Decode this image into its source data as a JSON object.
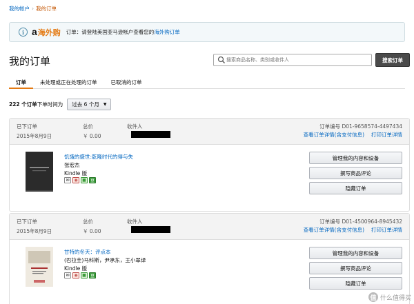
{
  "breadcrumb": {
    "account": "我的帐户",
    "separator": "›",
    "current": "我的订单"
  },
  "notice": {
    "icon": "info-icon",
    "logo_a": "a",
    "logo_cn": "海外购",
    "text_prefix": "订单：请登陆美国亚马逊帐户查看您的",
    "text_link": "海外购订单"
  },
  "page_title": "我的订单",
  "search": {
    "placeholder": "搜索商品名称、类别或收件人",
    "button_label": "搜索订单"
  },
  "tabs": [
    {
      "label": "订单",
      "active": true
    },
    {
      "label": "未处理或正在处理的订单",
      "active": false
    },
    {
      "label": "已取消的订单",
      "active": false
    }
  ],
  "filter": {
    "count": "222 个订单",
    "mid_text": "下单时间为",
    "selected": "过去 6 个月"
  },
  "orders": [
    {
      "placed_label": "已下订单",
      "placed_date": "2015年8月9日",
      "total_label": "总价",
      "total_value": "￥ 0.00",
      "recipient_label": "收件人",
      "order_number": "订单编号 D01-9658574-4497434",
      "details_link": "查看订单详情(含支付信息)",
      "print_link": "打印订单详情",
      "title": "饥饿的盛世:乾隆时代的得与失",
      "author": "张宏杰",
      "format": "Kindle 版",
      "actions": [
        "管理我的内容和设备",
        "撰写商品评论",
        "隐藏订单"
      ]
    },
    {
      "placed_label": "已下订单",
      "placed_date": "2015年8月9日",
      "total_label": "总价",
      "total_value": "￥ 0.00",
      "recipient_label": "收件人",
      "order_number": "订单编号 D01-4500964-8945432",
      "details_link": "查看订单详情(含支付信息)",
      "print_link": "打印订单详情",
      "title": "甘特的冬天：评点本",
      "author": "(巴拉圭)马科斯，尹承东，王小翠译",
      "format": "Kindle 版",
      "actions": [
        "管理我的内容和设备",
        "撰写商品评论",
        "隐藏订单"
      ]
    }
  ],
  "watermark": {
    "badge": "值",
    "text": "什么值得买"
  }
}
